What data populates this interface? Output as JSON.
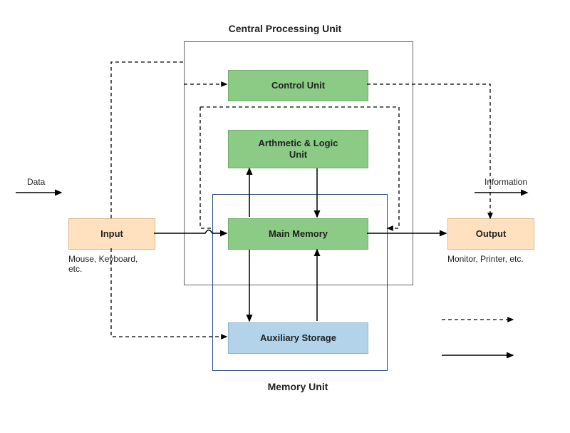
{
  "titles": {
    "cpu": "Central Processing Unit",
    "memory_unit": "Memory Unit"
  },
  "boxes": {
    "control_unit": "Control Unit",
    "alu": "Arthmetic & Logic\nUnit",
    "main_memory": "Main Memory",
    "aux_storage": "Auxiliary Storage",
    "input": "Input",
    "output": "Output"
  },
  "labels": {
    "data": "Data",
    "information": "Information",
    "input_caption": "Mouse, Keyboard,\netc.",
    "output_caption": "Monitor, Printer, etc."
  },
  "legend": {
    "dashed": "",
    "solid": ""
  },
  "colors": {
    "green": "#8BCB85",
    "peach": "#FFE1BF",
    "blue": "#B2D3EA",
    "border": "#666666",
    "arrow": "#000000"
  }
}
